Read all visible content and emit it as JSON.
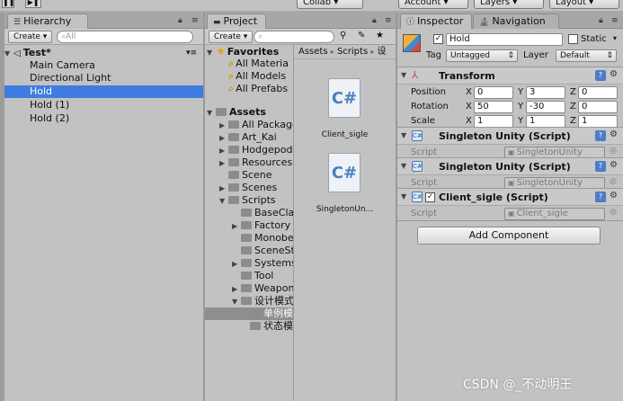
{
  "toolbar": {
    "collab": "Collab ▾",
    "account": "Account ▾",
    "layers": "Layers ▾",
    "layout": "Layout ▾"
  },
  "hierarchy": {
    "tab": "Hierarchy",
    "create": "Create ▾",
    "search_placeholder": "All",
    "scene": "Test*",
    "items": [
      "Main Camera",
      "Directional Light",
      "Hold",
      "Hold (1)",
      "Hold (2)"
    ]
  },
  "project": {
    "tab": "Project",
    "create": "Create ▾",
    "favorites": {
      "label": "Favorites",
      "items": [
        "All Materia",
        "All Models",
        "All Prefabs"
      ]
    },
    "assets": {
      "label": "Assets",
      "folders": [
        "All Package",
        "Art_Kai",
        "Hodgepodg",
        "Resources",
        "Scene",
        "Scenes",
        "Scripts"
      ],
      "scripts_children": [
        "BaseCla",
        "Factory",
        "Monobeh",
        "SceneSt",
        "Systems",
        "Tool",
        "Weapon",
        "设计模式"
      ],
      "design_children": [
        "单例模",
        "状态模"
      ]
    },
    "breadcrumb": {
      "root": "Assets",
      "sep": "▸",
      "child": "Scripts",
      "more": "设"
    },
    "files": [
      {
        "name": "Client_sigle",
        "glyph": "C#"
      },
      {
        "name": "SingletonUn...",
        "glyph": "C#"
      }
    ]
  },
  "inspector": {
    "tab": "Inspector",
    "tab2": "Navigation",
    "object_name": "Hold",
    "static_label": "Static",
    "tag_label": "Tag",
    "tag_value": "Untagged",
    "layer_label": "Layer",
    "layer_value": "Default",
    "transform": {
      "title": "Transform",
      "position_label": "Position",
      "rotation_label": "Rotation",
      "scale_label": "Scale",
      "x": "X",
      "y": "Y",
      "z": "Z",
      "position": [
        "0",
        "3",
        "0"
      ],
      "rotation": [
        "50",
        "-30",
        "0"
      ],
      "scale": [
        "1",
        "1",
        "1"
      ]
    },
    "components": [
      {
        "title": "Singleton Unity (Script)",
        "script_label": "Script",
        "script_value": "SingletonUnity"
      },
      {
        "title": "Singleton Unity (Script)",
        "script_label": "Script",
        "script_value": "SingletonUnity"
      },
      {
        "title": "Client_sigle (Script)",
        "script_label": "Script",
        "script_value": "Client_sigle"
      }
    ],
    "add_component": "Add Component"
  },
  "watermark": "CSDN @_不动明王",
  "colors": {
    "selection": "#3e7ce1",
    "panel": "#c2c2c2",
    "help": "#4d7cc8"
  }
}
